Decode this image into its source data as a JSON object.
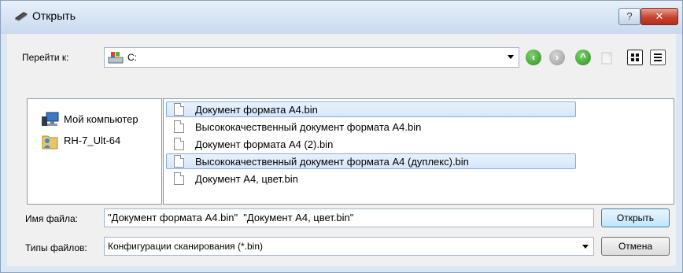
{
  "window": {
    "title": "Открыть",
    "help": "?",
    "close": "✕"
  },
  "toolbar": {
    "goto_label": "Перейти к:",
    "path": "C:"
  },
  "places": [
    {
      "label": "Мой компьютер",
      "icon": "computer-icon"
    },
    {
      "label": "RH-7_Ult-64",
      "icon": "user-folder-icon"
    }
  ],
  "files": [
    {
      "name": "Документ формата A4.bin",
      "selected": true
    },
    {
      "name": "Высококачественный документ формата A4.bin",
      "selected": false
    },
    {
      "name": "Документ формата A4 (2).bin",
      "selected": false
    },
    {
      "name": "Высококачественный документ формата A4 (дуплекс).bin",
      "selected": true
    },
    {
      "name": "Документ A4, цвет.bin",
      "selected": false
    }
  ],
  "filename": {
    "label": "Имя файла:",
    "value": "\"Документ формата A4.bin\"  \"Документ A4, цвет.bin\""
  },
  "filetype": {
    "label": "Типы файлов:",
    "value": "Конфигурации сканирования (*.bin)"
  },
  "buttons": {
    "open": "Открыть",
    "cancel": "Отмена"
  }
}
